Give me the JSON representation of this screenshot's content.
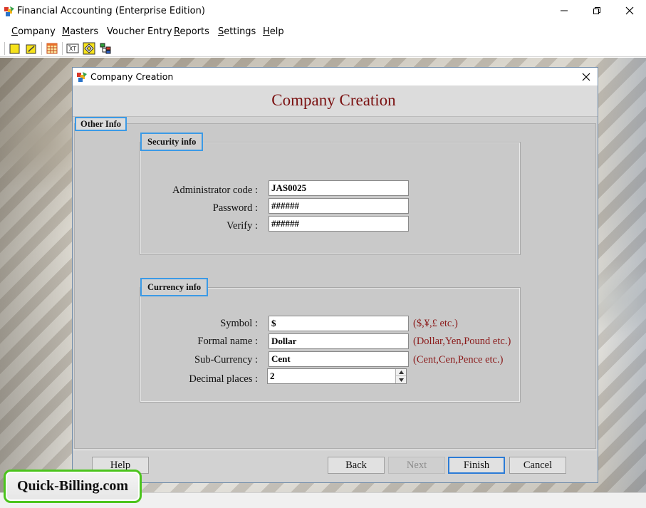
{
  "window": {
    "title": "Financial Accounting (Enterprise Edition)"
  },
  "menu": {
    "items": [
      {
        "first": "C",
        "rest": "ompany"
      },
      {
        "first": "M",
        "rest": "asters"
      },
      {
        "first": "",
        "rest": "Voucher Entry"
      },
      {
        "first": "R",
        "rest": "eports"
      },
      {
        "first": "S",
        "rest": "ettings"
      },
      {
        "first": "H",
        "rest": "elp"
      }
    ]
  },
  "toolbar": {
    "icons": [
      "new-company-icon",
      "open-company-icon",
      "grid-icon",
      "currency-icon",
      "diamond-icon",
      "tree-icon"
    ]
  },
  "dialog": {
    "title": "Company Creation",
    "heading": "Company Creation",
    "tab": "Other Info",
    "security": {
      "label": "Security info",
      "admin_label": "Administrator code :",
      "admin_value": "JAS0025",
      "password_label": "Password :",
      "password_value": "######",
      "verify_label": "Verify :",
      "verify_value": "######"
    },
    "currency": {
      "label": "Currency info",
      "symbol_label": "Symbol :",
      "symbol_value": "$",
      "symbol_hint": "($,¥,£ etc.)",
      "formal_label": "Formal name :",
      "formal_value": "Dollar",
      "formal_hint": "(Dollar,Yen,Pound etc.)",
      "sub_label": "Sub-Currency :",
      "sub_value": "Cent",
      "sub_hint": "(Cent,Cen,Pence etc.)",
      "decimal_label": "Decimal places :",
      "decimal_value": "2"
    },
    "buttons": {
      "help": "Help",
      "back": "Back",
      "next": "Next",
      "finish": "Finish",
      "cancel": "Cancel"
    }
  },
  "brand": {
    "text": "Quick-Billing.com",
    "border_color": "#4cc41d"
  },
  "colors": {
    "heading": "#7a1010",
    "hint": "#8b1a1a",
    "focus_border": "#3b9ae6"
  }
}
